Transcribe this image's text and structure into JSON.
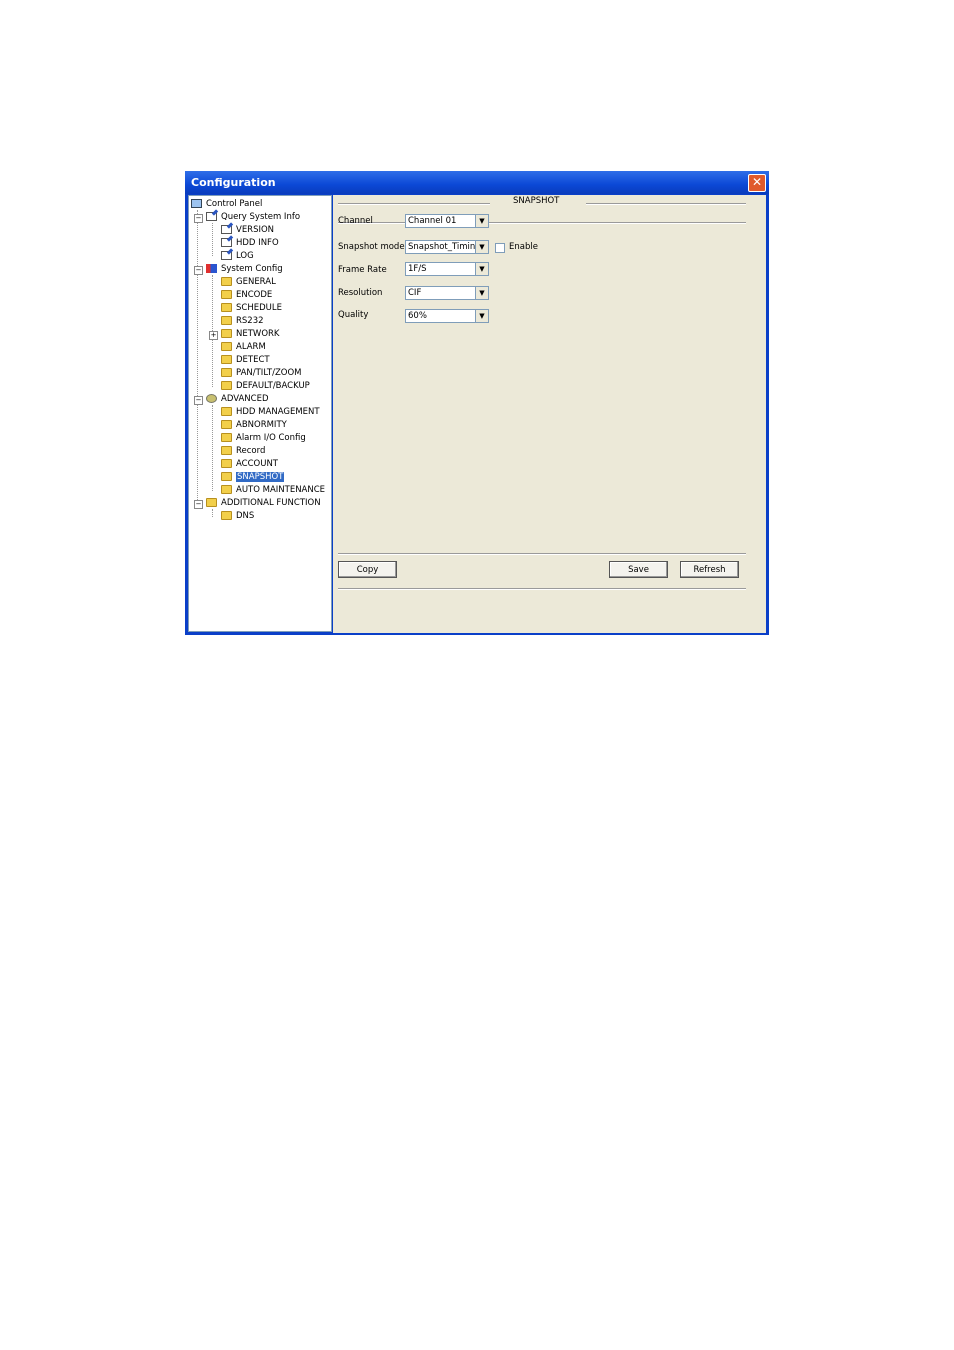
{
  "window": {
    "title": "Configuration",
    "close_glyph": "✕"
  },
  "tree": {
    "root": "Control Panel",
    "query": {
      "label": "Query System Info",
      "items": [
        "VERSION",
        "HDD INFO",
        "LOG"
      ]
    },
    "system": {
      "label": "System Config",
      "items": [
        "GENERAL",
        "ENCODE",
        "SCHEDULE",
        "RS232",
        "NETWORK",
        "ALARM",
        "DETECT",
        "PAN/TILT/ZOOM",
        "DEFAULT/BACKUP"
      ]
    },
    "advanced": {
      "label": "ADVANCED",
      "items": [
        "HDD MANAGEMENT",
        "ABNORMITY",
        "Alarm I/O Config",
        "Record",
        "ACCOUNT",
        "SNAPSHOT",
        "AUTO MAINTENANCE"
      ]
    },
    "additional": {
      "label": "ADDITIONAL FUNCTION",
      "items": [
        "DNS"
      ]
    },
    "selected": "SNAPSHOT"
  },
  "snapshot": {
    "section_title": "SNAPSHOT",
    "channel_label": "Channel",
    "channel_value": "Channel 01",
    "mode_label": "Snapshot mode",
    "mode_value": "Snapshot_Timing",
    "enable_label": "Enable",
    "enable_checked": false,
    "frame_rate_label": "Frame Rate",
    "frame_rate_value": "1F/S",
    "resolution_label": "Resolution",
    "resolution_value": "CIF",
    "quality_label": "Quality",
    "quality_value": "60%"
  },
  "buttons": {
    "copy": "Copy",
    "save": "Save",
    "refresh": "Refresh"
  },
  "colors": {
    "titlebar": "#0b48d6",
    "selection": "#316ac5",
    "panel_bg": "#ece9d8"
  }
}
